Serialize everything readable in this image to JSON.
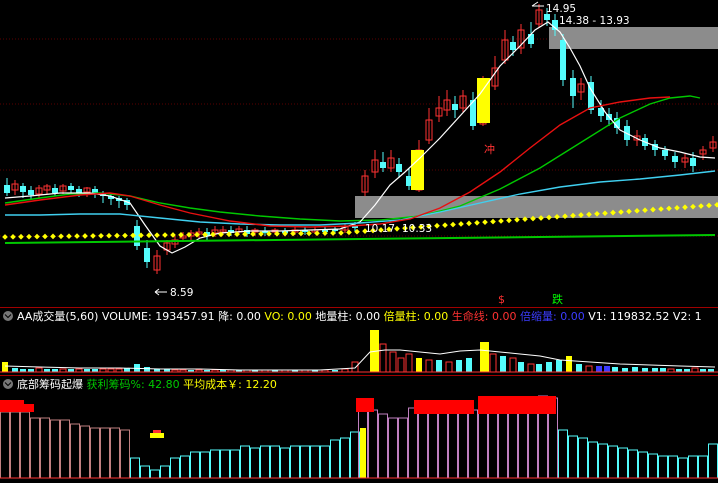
{
  "colors": {
    "background": "#000000",
    "up": "#ff3232",
    "down": "#54fcfc",
    "yellow": "#ffff00",
    "white": "#ffffff",
    "green": "#00c800",
    "red_line": "#e81010",
    "cyan_line": "#40d0f0",
    "zone_gray": "#8c8c8c",
    "panel_border": "#a00000"
  },
  "price_panel": {
    "high_label": "14.95",
    "range_label": "14.38 - 13.93",
    "low_label": "8.59",
    "zone_label_1": "10.17",
    "zone_label_2": "10.33",
    "chong_label": "冲"
  },
  "volume_panel": {
    "markers": {
      "buy": "$",
      "fall": "跌"
    },
    "indicators": [
      {
        "text": "AA成交量(5,60)",
        "color": "#ffffff"
      },
      {
        "text": "VOLUME: 193457.91",
        "color": "#ffffff"
      },
      {
        "text": "降: 0.00",
        "color": "#ffffff"
      },
      {
        "text": "VO: 0.00",
        "color": "#ffff00"
      },
      {
        "text": "地量柱: 0.00",
        "color": "#ffffff"
      },
      {
        "text": "倍量柱: 0.00",
        "color": "#ffff00"
      },
      {
        "text": "生命线: 0.00",
        "color": "#ff3232"
      },
      {
        "text": "倍缩量: 0.00",
        "color": "#3c3cff"
      },
      {
        "text": "V1: 119832.52",
        "color": "#ffffff"
      },
      {
        "text": "V2: 1",
        "color": "#ffffff"
      }
    ]
  },
  "chip_panel": {
    "indicators": [
      {
        "text": "底部筹码起爆",
        "color": "#ffffff"
      },
      {
        "text": "获利筹码%: 42.80",
        "color": "#00c800"
      },
      {
        "text": "平均成本￥: 12.20",
        "color": "#ffff00"
      }
    ]
  }
}
